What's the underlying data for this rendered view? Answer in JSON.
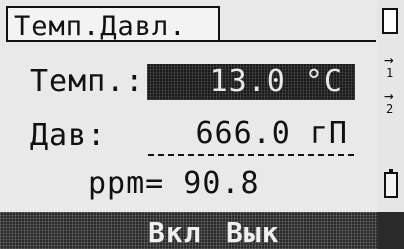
{
  "header": {
    "title": "Темп.Давл."
  },
  "rows": {
    "temp": {
      "label": "Темп.:",
      "value": "13.0 °C"
    },
    "pressure": {
      "label": "Дав:",
      "value": "666.0 гП"
    },
    "ppm": {
      "text": "ppm= 90.8"
    }
  },
  "softkeys": {
    "on": "Вкл",
    "off": "Вык"
  },
  "status": {
    "arrow1": "→",
    "digit1": "1",
    "arrow2": "→",
    "digit2": "2",
    "icons": [
      "display-icon",
      "arrow-icon",
      "arrow-icon",
      "battery-icon"
    ]
  }
}
